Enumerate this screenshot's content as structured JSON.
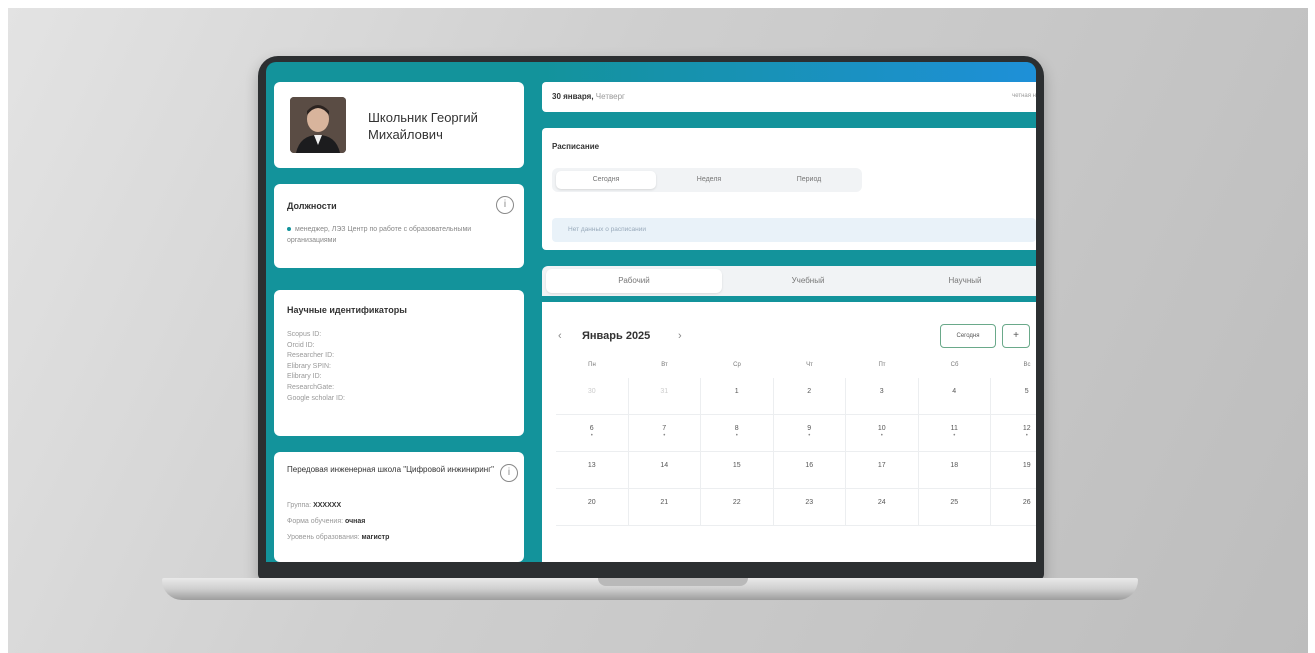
{
  "profile": {
    "name": "Школьник Георгий Михайлович"
  },
  "positions": {
    "title": "Должности",
    "info_icon": "i",
    "entry": "менеджер, ЛЭЗ Центр по работе с образовательными организациями"
  },
  "scientific": {
    "title": "Научные идентификаторы",
    "items": [
      "Scopus ID:",
      "Orcid ID:",
      "Researcher ID:",
      "Elibrary SPIN:",
      "Elibrary ID:",
      "ResearchGate:",
      "Google scholar ID:"
    ]
  },
  "school": {
    "title": "Передовая инженерная школа \"Цифровой инжиниринг\"",
    "info_icon": "i",
    "group_label": "Группа:",
    "group_value": "ХХХХХХ",
    "form_label": "Форма обучения:",
    "form_value": "очная",
    "level_label": "Уровень образования:",
    "level_value": "магистр"
  },
  "datebar": {
    "date": "30 января,",
    "weekday": "Четверг",
    "right_text": "четная н"
  },
  "schedule": {
    "title": "Расписание",
    "segments": [
      "Сегодня",
      "Неделя",
      "Период"
    ],
    "empty_text": "Нет данных о расписании"
  },
  "tabs": [
    "Рабочий",
    "Учебный",
    "Научный"
  ],
  "calendar": {
    "month": "Январь 2025",
    "prev_icon": "‹",
    "next_icon": "›",
    "today_button": "Сегодня",
    "add_button": "+",
    "weekdays": [
      "Пн",
      "Вт",
      "Ср",
      "Чт",
      "Пт",
      "Сб",
      "Вс"
    ],
    "rows": [
      [
        "30",
        "31",
        "1",
        "2",
        "3",
        "4",
        "5"
      ],
      [
        "6",
        "7",
        "8",
        "9",
        "10",
        "11",
        "12"
      ],
      [
        "13",
        "14",
        "15",
        "16",
        "17",
        "18",
        "19"
      ],
      [
        "20",
        "21",
        "22",
        "23",
        "24",
        "25",
        "26"
      ]
    ]
  },
  "colors": {
    "accent": "#13939b",
    "card": "#ffffff"
  }
}
